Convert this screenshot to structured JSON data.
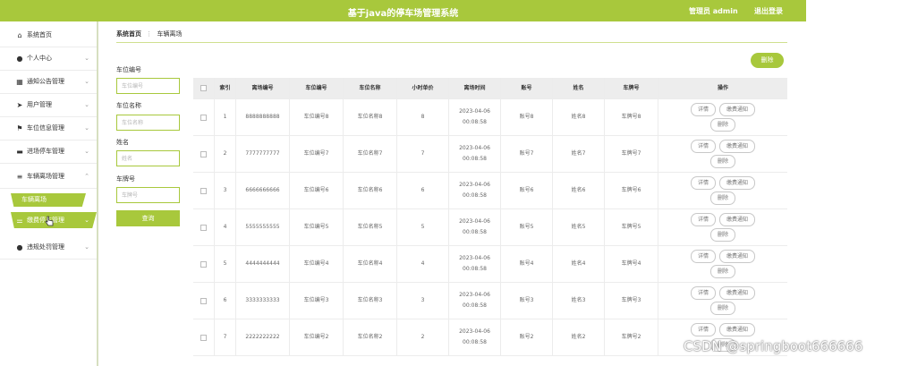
{
  "header": {
    "title": "基于java的停车场管理系统",
    "user": "管理员 admin",
    "logout": "退出登录"
  },
  "sidebar": {
    "items": [
      {
        "icon": "home-icon",
        "glyph": "⌂",
        "label": "系统首页",
        "chevron": ""
      },
      {
        "icon": "person-icon",
        "glyph": "●",
        "label": "个人中心",
        "chevron": "⌄"
      },
      {
        "icon": "grid-icon",
        "glyph": "▦",
        "label": "通知公告管理",
        "chevron": "⌄"
      },
      {
        "icon": "send-icon",
        "glyph": "➤",
        "label": "用户管理",
        "chevron": "⌄"
      },
      {
        "icon": "flag-icon",
        "glyph": "⚑",
        "label": "车位信息管理",
        "chevron": "⌄"
      },
      {
        "icon": "monitor-icon",
        "glyph": "▬",
        "label": "进场停车管理",
        "chevron": "⌄"
      },
      {
        "icon": "list-icon",
        "glyph": "≡",
        "label": "车辆离场管理",
        "chevron": "⌃"
      },
      {
        "icon": "sliders-icon",
        "glyph": "⚌",
        "label": "缴费停车管理",
        "chevron": "⌄"
      },
      {
        "icon": "person-icon",
        "glyph": "●",
        "label": "违规处罚管理",
        "chevron": "⌄"
      }
    ],
    "sub_active": "车辆离场"
  },
  "breadcrumb": {
    "home": "系统首页",
    "sep": "⋮",
    "current": "车辆离场"
  },
  "toolbar": {
    "delete_label": "删除"
  },
  "filters": [
    {
      "label": "车位编号",
      "placeholder": "车位编号"
    },
    {
      "label": "车位名称",
      "placeholder": "车位名称"
    },
    {
      "label": "姓名",
      "placeholder": "姓名"
    },
    {
      "label": "车牌号",
      "placeholder": "车牌号"
    }
  ],
  "search_label": "查询",
  "table": {
    "headers": [
      "",
      "索引",
      "离场编号",
      "车位编号",
      "车位名称",
      "小时单价",
      "离场时间",
      "账号",
      "姓名",
      "车牌号",
      "操作"
    ],
    "rows": [
      {
        "index": "1",
        "code": "8888888888",
        "spot_no": "车位编号8",
        "spot_name": "车位名称8",
        "price": "8",
        "time": "2023-04-06 00:08:58",
        "account": "账号8",
        "name": "姓名8",
        "plate": "车牌号8"
      },
      {
        "index": "2",
        "code": "7777777777",
        "spot_no": "车位编号7",
        "spot_name": "车位名称7",
        "price": "7",
        "time": "2023-04-06 00:08:58",
        "account": "账号7",
        "name": "姓名7",
        "plate": "车牌号7"
      },
      {
        "index": "3",
        "code": "6666666666",
        "spot_no": "车位编号6",
        "spot_name": "车位名称6",
        "price": "6",
        "time": "2023-04-06 00:08:58",
        "account": "账号6",
        "name": "姓名6",
        "plate": "车牌号6"
      },
      {
        "index": "4",
        "code": "5555555555",
        "spot_no": "车位编号5",
        "spot_name": "车位名称5",
        "price": "5",
        "time": "2023-04-06 00:08:58",
        "account": "账号5",
        "name": "姓名5",
        "plate": "车牌号5"
      },
      {
        "index": "5",
        "code": "4444444444",
        "spot_no": "车位编号4",
        "spot_name": "车位名称4",
        "price": "4",
        "time": "2023-04-06 00:08:58",
        "account": "账号4",
        "name": "姓名4",
        "plate": "车牌号4"
      },
      {
        "index": "6",
        "code": "3333333333",
        "spot_no": "车位编号3",
        "spot_name": "车位名称3",
        "price": "3",
        "time": "2023-04-06 00:08:58",
        "account": "账号3",
        "name": "姓名3",
        "plate": "车牌号3"
      },
      {
        "index": "7",
        "code": "2222222222",
        "spot_no": "车位编号2",
        "spot_name": "车位名称2",
        "price": "2",
        "time": "2023-04-06 00:08:58",
        "account": "账号2",
        "name": "姓名2",
        "plate": "车牌号2"
      }
    ],
    "actions": {
      "detail": "详情",
      "notify": "缴费通知",
      "delete": "删除"
    }
  },
  "watermark": "CSDN @springboot666666",
  "colors": {
    "accent": "#a8c83c",
    "header_bg": "#ededed"
  }
}
